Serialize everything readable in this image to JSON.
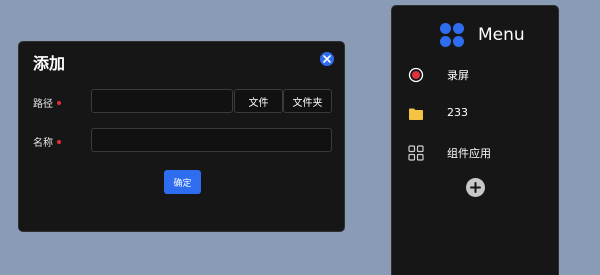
{
  "dialog": {
    "title": "添加",
    "close_icon": "close-circle-icon",
    "fields": {
      "path": {
        "label": "路径",
        "value": "",
        "placeholder": ""
      },
      "name": {
        "label": "名称",
        "value": "",
        "placeholder": ""
      }
    },
    "buttons": {
      "file": "文件",
      "folder": "文件夹",
      "confirm": "确定"
    },
    "colors": {
      "accent": "#2f6df0",
      "required": "#e0303a",
      "background": "#161616"
    }
  },
  "menu": {
    "title": "Menu",
    "logo_icon": "four-petal-logo-icon",
    "items": [
      {
        "label": "录屏",
        "icon": "record-icon"
      },
      {
        "label": "233",
        "icon": "folder-icon"
      },
      {
        "label": "组件应用",
        "icon": "grid-icon"
      }
    ],
    "add_icon": "plus-circle-icon",
    "colors": {
      "logo": "#2f6df0",
      "folder": "#f4c542",
      "record": "#e0303a"
    }
  }
}
